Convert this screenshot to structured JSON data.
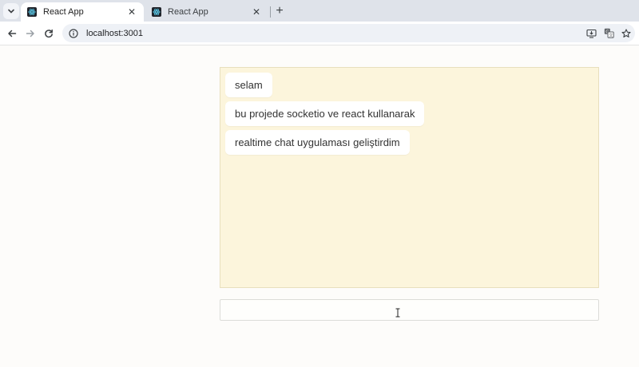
{
  "browser": {
    "tabs": [
      {
        "title": "React App",
        "active": true
      },
      {
        "title": "React App",
        "active": false
      }
    ],
    "url": "localhost:3001",
    "icons": {
      "tab_search": "chevron-down-icon",
      "close": "close-icon",
      "new_tab": "plus-icon",
      "back": "back-arrow-icon",
      "forward": "forward-arrow-icon",
      "reload": "reload-icon",
      "site_info": "info-icon",
      "install": "install-app-icon",
      "translate": "translate-icon",
      "bookmark": "star-icon"
    },
    "colors": {
      "tabstrip": "#dfe3ea",
      "omnibox": "#eef1f6"
    }
  },
  "chat": {
    "messages": [
      {
        "text": "selam"
      },
      {
        "text": "bu projede socketio ve react kullanarak"
      },
      {
        "text": "realtime chat uygulaması geliştirdim"
      }
    ],
    "input": {
      "value": "",
      "placeholder": ""
    },
    "colors": {
      "panel_bg": "#fcf5dc",
      "bubble_bg": "#ffffff",
      "page_bg": "#fdfcfa"
    }
  }
}
